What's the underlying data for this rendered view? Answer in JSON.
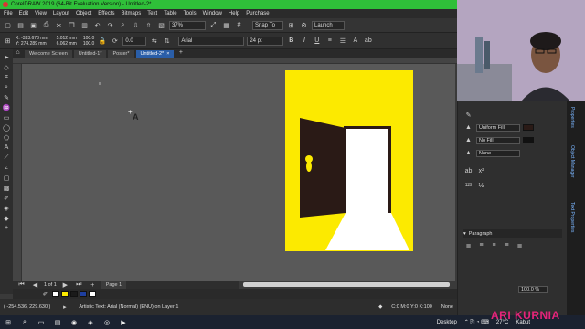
{
  "window": {
    "title": "CorelDRAW 2019 (64-Bit Evaluation Version) - Untitled-2*"
  },
  "menu": [
    "File",
    "Edit",
    "View",
    "Layout",
    "Object",
    "Effects",
    "Bitmaps",
    "Text",
    "Table",
    "Tools",
    "Window",
    "Help",
    "Purchase"
  ],
  "standard_bar": {
    "zoom": "37%",
    "snap": "Snap To",
    "launch": "Launch"
  },
  "property_bar": {
    "x": "X: -323.673 mm",
    "y": "Y: 274.289 mm",
    "w": "5.012 mm",
    "h": "6.062 mm",
    "w_pct": "100.0",
    "h_pct": "100.0",
    "angle": "0.0",
    "font": "Arial",
    "size": "24 pt",
    "bold": "B",
    "italic": "I",
    "underline": "U"
  },
  "tabs": [
    "Welcome Screen",
    "Untitled-1*",
    "Poster*",
    "Untitled-2*"
  ],
  "active_tab": 3,
  "canvas": {
    "cursor_label": "A"
  },
  "page_nav": {
    "page_of": "1  of  1",
    "page_label": "Page 1"
  },
  "palette_colors": [
    "#ffffff",
    "#fcea00",
    "#1a1a1a",
    "#1e3fa0",
    "#ffffff"
  ],
  "status": {
    "coords": "( -254.536, 229.630 )",
    "info": "Artistic Text: Arial (Normal) (ENU) on Layer 1",
    "color": "C:0 M:0 Y:0 K:100",
    "outline": "None"
  },
  "right_panel": {
    "fill_1": "Uniform Fill",
    "fill_2": "No Fill",
    "fill_3": "None",
    "paragraph": "Paragraph",
    "percent": "100.0 %",
    "tab_1": "Properties",
    "tab_2": "Object Manager",
    "tab_3": "Text Properties"
  },
  "taskbar": {
    "desktop": "Desktop",
    "temp": "27°C",
    "weather": "Kabut"
  },
  "watermark": "ARI KURNIA",
  "colors": {
    "titlebar": "#2fbf39",
    "poster_yellow": "#fcea00",
    "door_dark": "#2a1a16",
    "tab_active": "#2a5ea8"
  }
}
